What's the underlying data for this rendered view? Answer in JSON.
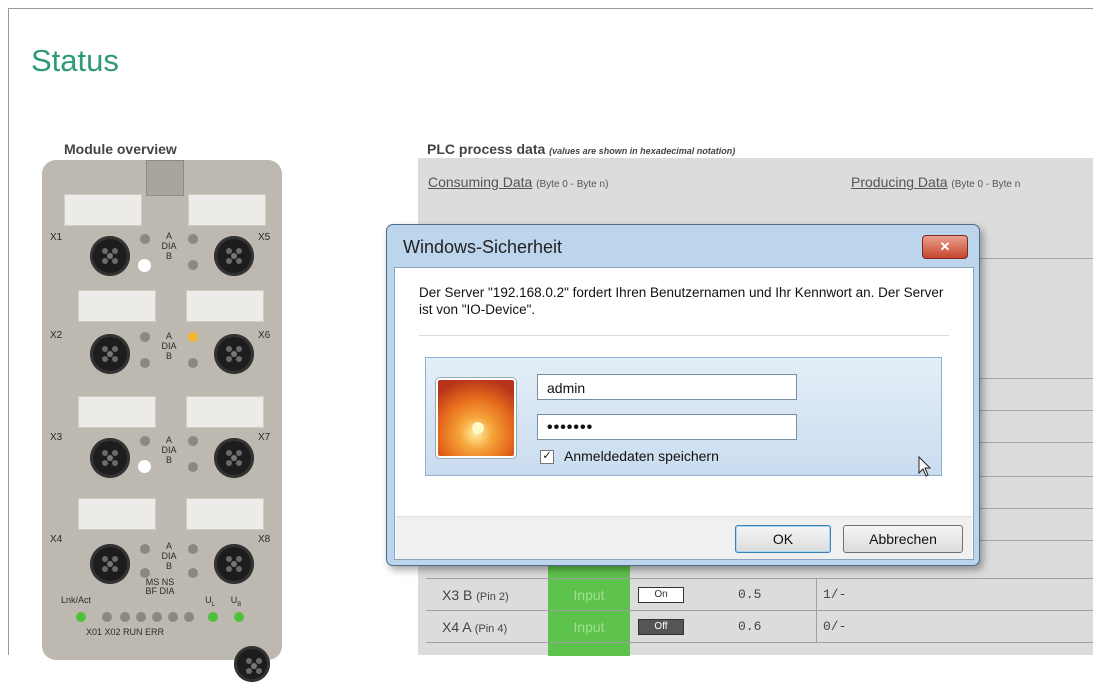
{
  "page": {
    "title": "Status"
  },
  "module_overview": {
    "title": "Module overview",
    "ports": [
      {
        "left": "X1",
        "right": "X5"
      },
      {
        "left": "X2",
        "right": "X6"
      },
      {
        "left": "X3",
        "right": "X7"
      },
      {
        "left": "X4",
        "right": "X8"
      }
    ],
    "led_a": "A",
    "led_dia": "DIA",
    "led_b": "B",
    "bottom_labels": {
      "lnk": "Lnk/Act",
      "ms_ns": "MS NS",
      "bf_dia": "BF DIA",
      "ul": "U",
      "ul_sub": "L",
      "ub": "U",
      "ub_sub": "B",
      "row2": "X01 X02 RUN ERR"
    }
  },
  "plc": {
    "title": "PLC process data",
    "subtitle": "(values are shown in hexadecimal notation)",
    "consuming": "Consuming Data",
    "consuming_range": "(Byte 0 - Byte n)",
    "producing": "Producing Data",
    "producing_range": "(Byte 0 - Byte n",
    "rows": [
      {
        "name": "X3 B",
        "pin": "(Pin 2)",
        "type": "Input",
        "value": "On",
        "state": "on",
        "num": "0.5",
        "status": "1/-"
      },
      {
        "name": "X4 A",
        "pin": "(Pin 4)",
        "type": "Input",
        "value": "Off",
        "state": "off",
        "num": "0.6",
        "status": "0/-"
      }
    ]
  },
  "dialog": {
    "title": "Windows-Sicherheit",
    "close": "✕",
    "message": "Der Server \"192.168.0.2\" fordert Ihren Benutzernamen und Ihr Kennwort an. Der Server ist von \"IO-Device\".",
    "username": "admin",
    "password": "•••••••",
    "remember_label": "Anmeldedaten speichern",
    "remember_checked": "✓",
    "ok": "OK",
    "cancel": "Abbrechen"
  },
  "colors": {
    "title_green": "#2e9a78",
    "input_green": "#5ec34c",
    "dialog_frame": "#bdd5ec"
  }
}
